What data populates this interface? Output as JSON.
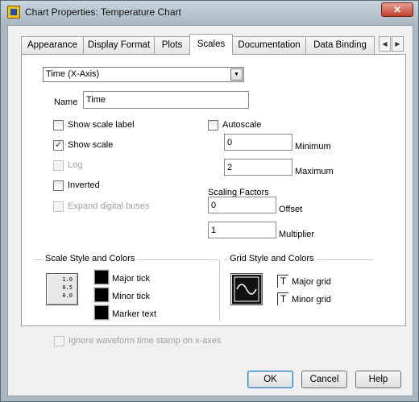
{
  "window": {
    "title": "Chart Properties: Temperature Chart",
    "close_label": "✕"
  },
  "tabs": [
    {
      "label": "Appearance",
      "active": false
    },
    {
      "label": "Display Format",
      "active": false
    },
    {
      "label": "Plots",
      "active": false
    },
    {
      "label": "Scales",
      "active": true
    },
    {
      "label": "Documentation",
      "active": false
    },
    {
      "label": "Data Binding",
      "active": false
    }
  ],
  "tab_scroll": {
    "left_icon": "◀",
    "right_icon": "▶"
  },
  "scales": {
    "axis_select": {
      "value": "Time (X-Axis)",
      "arrow": "▼"
    },
    "name_label": "Name",
    "name_value": "Time",
    "show_scale_label": {
      "label": "Show scale label",
      "checked": false
    },
    "show_scale": {
      "label": "Show scale",
      "checked": true
    },
    "log": {
      "label": "Log",
      "checked": false,
      "disabled": true
    },
    "inverted": {
      "label": "Inverted",
      "checked": false
    },
    "expand_digital": {
      "label": "Expand digital buses",
      "checked": false,
      "disabled": true
    },
    "autoscale": {
      "label": "Autoscale",
      "checked": false
    },
    "minimum": {
      "label": "Minimum",
      "value": "0"
    },
    "maximum": {
      "label": "Maximum",
      "value": "2"
    },
    "scaling_factors": {
      "title": "Scaling Factors",
      "offset": {
        "label": "Offset",
        "value": "0"
      },
      "multiplier": {
        "label": "Multiplier",
        "value": "1"
      }
    },
    "scale_style": {
      "title": "Scale Style and Colors",
      "icon_text": [
        "1.0",
        "0.5",
        "0.0"
      ],
      "major_tick": {
        "label": "Major tick",
        "color": "#000000"
      },
      "minor_tick": {
        "label": "Minor tick",
        "color": "#000000"
      },
      "marker_text": {
        "label": "Marker text",
        "color": "#000000"
      }
    },
    "grid_style": {
      "title": "Grid Style and Colors",
      "major_grid": {
        "label": "Major grid",
        "icon": "T"
      },
      "minor_grid": {
        "label": "Minor grid",
        "icon": "T"
      }
    },
    "ignore_timestamp": {
      "label": "Ignore waveform time stamp on x-axes",
      "checked": false,
      "disabled": true
    }
  },
  "buttons": {
    "ok": "OK",
    "cancel": "Cancel",
    "help": "Help"
  }
}
